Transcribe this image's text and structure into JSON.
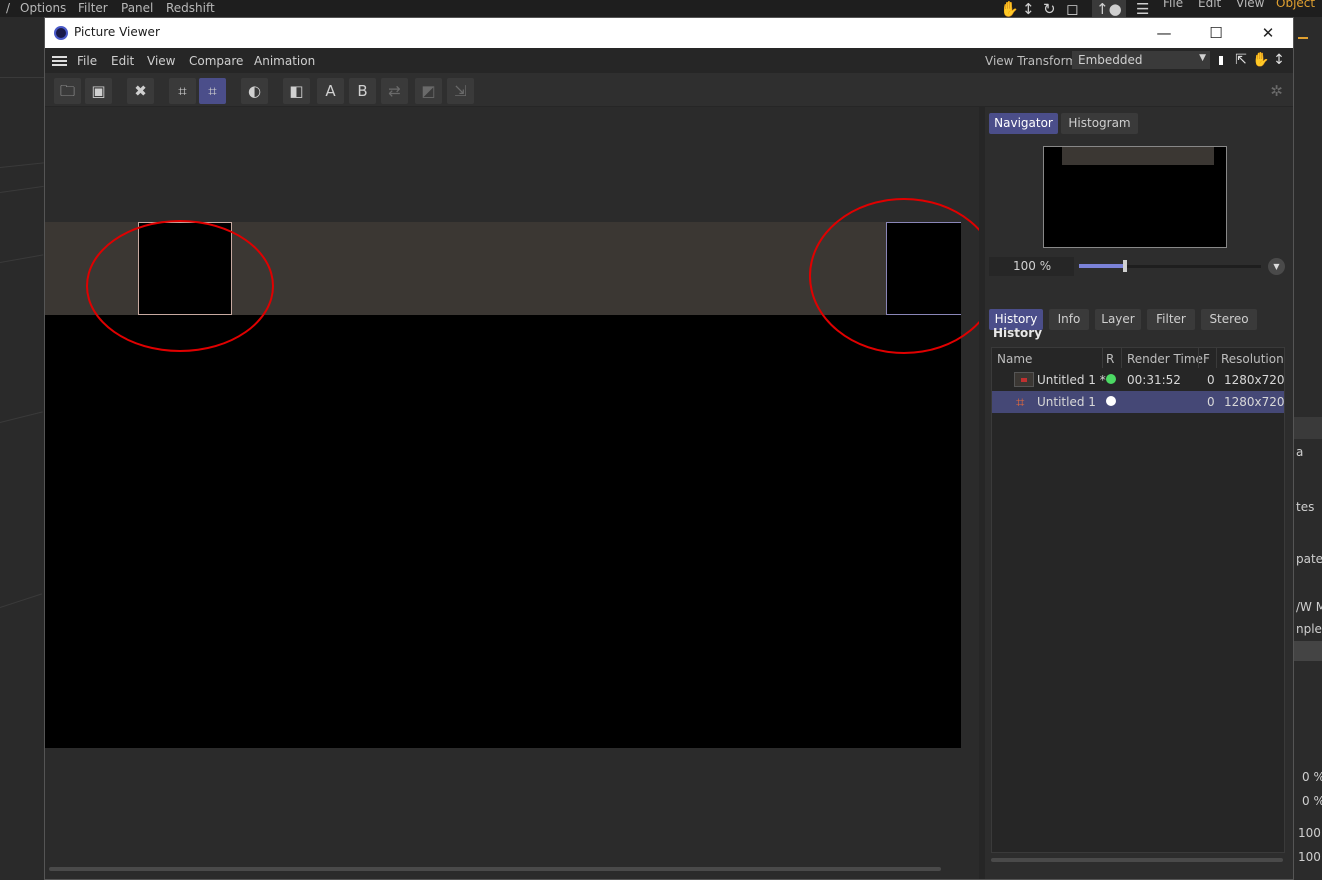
{
  "host": {
    "menu": [
      "Options",
      "Filter",
      "Panel",
      "Redshift"
    ],
    "right_menu": [
      "File",
      "Edit",
      "View"
    ],
    "right_object": "Object",
    "right_fragments": [
      "a",
      "tes",
      "pated",
      "/W M",
      "nple",
      "0 %",
      "0 %",
      "100",
      "100"
    ]
  },
  "window": {
    "title": "Picture Viewer",
    "controls": {
      "minimize": "—",
      "maximize": "☐",
      "close": "✕"
    }
  },
  "menubar": {
    "items": [
      "File",
      "Edit",
      "View",
      "Compare",
      "Animation"
    ],
    "view_transform_label": "View Transform",
    "view_transform_value": "Embedded"
  },
  "toolbar": {
    "compare_a": "A",
    "compare_b": "B"
  },
  "panel": {
    "top_tabs": [
      "Navigator",
      "Histogram"
    ],
    "zoom": "100 %",
    "zoom_fraction": 0.25,
    "bottom_tabs": [
      "History",
      "Info",
      "Layer",
      "Filter",
      "Stereo"
    ],
    "history_title": "History",
    "columns": [
      "Name",
      "R",
      "Render Time",
      "F",
      "Resolution"
    ],
    "rows": [
      {
        "name": "Untitled 1 *",
        "status": "green",
        "render_time": "00:31:52",
        "frame": "0",
        "resolution": "1280x720"
      },
      {
        "name": "Untitled 1",
        "status": "white",
        "render_time": "",
        "frame": "0",
        "resolution": "1280x720"
      }
    ]
  },
  "colors": {
    "accent": "#4b4e8a",
    "annotation": "#e00000",
    "status_green": "#4cd964",
    "status_white": "#ffffff"
  }
}
